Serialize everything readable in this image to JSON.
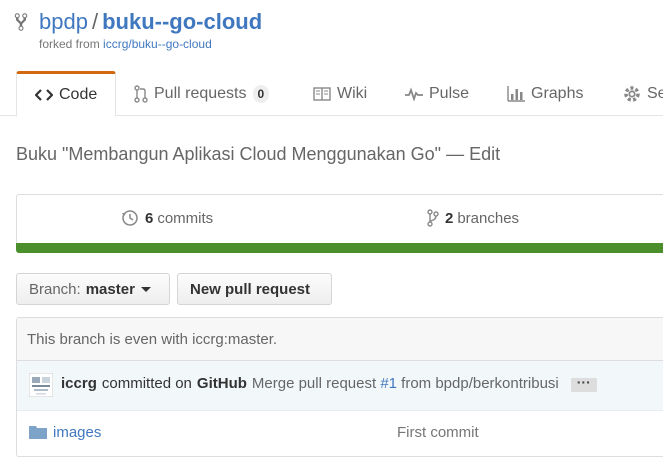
{
  "header": {
    "owner": "bpdp",
    "separator": "/",
    "repo": "buku--go-cloud",
    "forked_prefix": "forked from",
    "forked_source": "iccrg/buku--go-cloud"
  },
  "tabs": [
    {
      "label": "Code",
      "icon": "code-icon",
      "selected": true
    },
    {
      "label": "Pull requests",
      "icon": "pull-request-icon",
      "count": "0"
    },
    {
      "label": "Wiki",
      "icon": "book-icon"
    },
    {
      "label": "Pulse",
      "icon": "pulse-icon"
    },
    {
      "label": "Graphs",
      "icon": "graph-icon"
    },
    {
      "label": "Se",
      "icon": "gear-icon"
    }
  ],
  "description": {
    "text": "Buku \"Membangun Aplikasi Cloud Menggunakan Go\"",
    "dash": "—",
    "edit": "Edit"
  },
  "numbers": {
    "commits_count": "6",
    "commits_label": "commits",
    "branches_count": "2",
    "branches_label": "branches"
  },
  "language_bar_color": "#4a8f2b",
  "branch": {
    "label": "Branch:",
    "name": "master"
  },
  "new_pr_label": "New pull request",
  "status_text": "This branch is even with iccrg:master.",
  "commit": {
    "author": "iccrg",
    "action": "committed on",
    "platform": "GitHub",
    "message_prefix": "Merge pull request",
    "pr_ref": "#1",
    "message_suffix": "from bpdp/berkontribusi",
    "ellipsis": "···"
  },
  "files": [
    {
      "name": "images",
      "type": "folder",
      "message": "First commit"
    }
  ]
}
